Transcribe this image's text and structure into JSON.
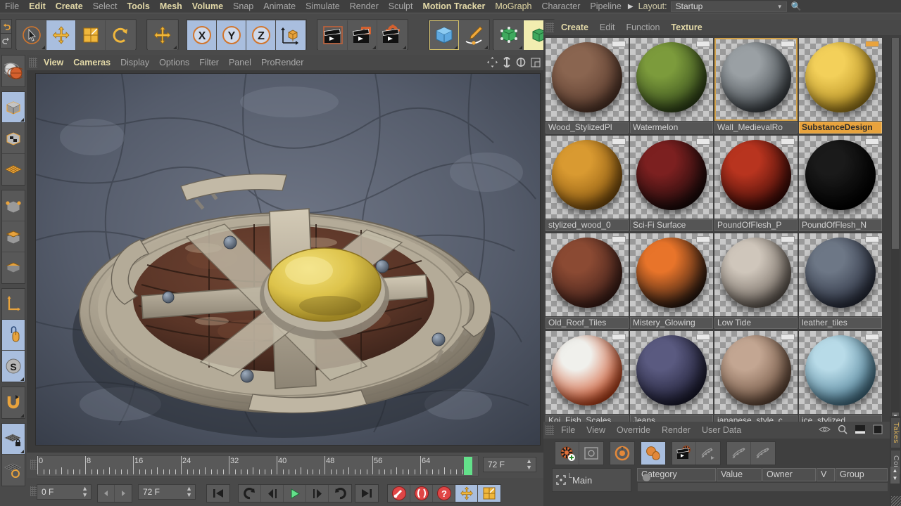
{
  "menubar": {
    "items": [
      {
        "label": "File",
        "state": "dim"
      },
      {
        "label": "Edit",
        "state": "lit"
      },
      {
        "label": "Create",
        "state": "lit"
      },
      {
        "label": "Select",
        "state": "dim"
      },
      {
        "label": "Tools",
        "state": "lit"
      },
      {
        "label": "Mesh",
        "state": "lit"
      },
      {
        "label": "Volume",
        "state": "lit"
      },
      {
        "label": "Snap",
        "state": "dim"
      },
      {
        "label": "Animate",
        "state": "dim"
      },
      {
        "label": "Simulate",
        "state": "dim"
      },
      {
        "label": "Render",
        "state": "dim"
      },
      {
        "label": "Sculpt",
        "state": "dim"
      },
      {
        "label": "Motion Tracker",
        "state": "lit"
      },
      {
        "label": "MoGraph",
        "state": "lit2"
      },
      {
        "label": "Character",
        "state": "dim"
      },
      {
        "label": "Pipeline",
        "state": "dim"
      }
    ],
    "layout_label": "Layout:",
    "layout_value": "Startup",
    "search_icon": "search-icon"
  },
  "toolbar": {
    "undo_redo_group": [
      {
        "icon": "undo-icon"
      },
      {
        "icon": "redo-icon"
      }
    ],
    "selection_group": [
      {
        "icon": "live-selection-icon",
        "state": "normal"
      },
      {
        "icon": "move-icon",
        "state": "selected"
      },
      {
        "icon": "scale-icon",
        "state": "normal"
      },
      {
        "icon": "rotate-icon",
        "state": "normal"
      }
    ],
    "axis_group": [
      {
        "icon": "move-axis-icon",
        "state": "normal"
      }
    ],
    "xyz_group": [
      {
        "icon": "x-axis-icon",
        "label": "X",
        "state": "selected"
      },
      {
        "icon": "y-axis-icon",
        "label": "Y",
        "state": "selected"
      },
      {
        "icon": "z-axis-icon",
        "label": "Z",
        "state": "selected"
      },
      {
        "icon": "world-coordinate-icon",
        "state": "selected"
      }
    ],
    "render_group": [
      {
        "icon": "render-view-icon"
      },
      {
        "icon": "render-to-picture-viewer-icon"
      },
      {
        "icon": "render-settings-icon"
      }
    ],
    "primitive_group": [
      {
        "icon": "cube-primitive-icon",
        "state": "highlight"
      },
      {
        "icon": "spline-pen-icon",
        "state": "normal"
      }
    ],
    "generator_group": [
      {
        "icon": "subdivision-surface-icon",
        "state": "normal"
      },
      {
        "icon": "array-generator-icon",
        "state": "yellow"
      }
    ]
  },
  "left_toolbar": {
    "items": [
      {
        "icon": "transform-object-icon",
        "state": "normal"
      },
      {
        "icon": "model-mode-icon",
        "state": "selected"
      },
      {
        "icon": "texture-mode-icon",
        "state": "normal"
      },
      {
        "icon": "points-mode-icon",
        "state": "normal"
      },
      {
        "icon": "polygon-mode-icon",
        "state": "normal"
      },
      {
        "icon": "edge-mode-icon",
        "state": "normal"
      },
      {
        "icon": "axis-mode-icon",
        "state": "normal"
      },
      {
        "icon": "world-axis-icon",
        "state": "normal"
      },
      {
        "icon": "viewport-solo-icon",
        "state": "selected"
      },
      {
        "icon": "snap-toggle-icon",
        "state": "selected"
      },
      {
        "icon": "magnet-icon",
        "state": "normal"
      },
      {
        "icon": "workplane-lock-icon",
        "state": "selected"
      },
      {
        "icon": "workplane-icon",
        "state": "normal"
      }
    ]
  },
  "viewport": {
    "menu_items": [
      "View",
      "Cameras",
      "Display",
      "Options",
      "Filter",
      "Panel",
      "ProRender"
    ],
    "menu_states": [
      "lit",
      "lit",
      "dim",
      "dim",
      "dim",
      "dim",
      "dim"
    ],
    "corner_icons": [
      "pan-view-icon",
      "dolly-view-icon",
      "rotate-view-icon",
      "maximize-view-icon"
    ],
    "scene_description": "Perspective view of a stylized medieval round wooden shield with stone tiles, metal rim and a golden boss, on rocky ground"
  },
  "timeline": {
    "ruler_labels": [
      "0",
      "8",
      "16",
      "24",
      "32",
      "40",
      "48",
      "56",
      "64"
    ],
    "ruler_values": [
      0,
      8,
      16,
      24,
      32,
      40,
      48,
      56,
      64
    ],
    "range_start": 0,
    "range_end": 72,
    "end_field": "72 F",
    "current_marker_frame": 72
  },
  "transport": {
    "current_frame": "0 F",
    "end_frame": "72 F",
    "buttons": [
      {
        "icon": "go-to-start-icon"
      },
      {
        "icon": "play-backwards-loop-icon"
      },
      {
        "icon": "previous-frame-icon"
      },
      {
        "icon": "play-forward-icon"
      },
      {
        "icon": "next-frame-icon"
      },
      {
        "icon": "play-forwards-loop-icon"
      },
      {
        "icon": "go-to-end-icon"
      },
      {
        "icon": "record-keyframe-icon"
      },
      {
        "icon": "autokeying-icon"
      },
      {
        "icon": "keyframe-selection-icon"
      },
      {
        "icon": "position-key-icon"
      },
      {
        "icon": "scale-key-icon"
      }
    ]
  },
  "material_manager": {
    "menu_items": [
      "Create",
      "Edit",
      "Function",
      "Texture"
    ],
    "menu_states": [
      "lit",
      "dim",
      "dim",
      "lit"
    ],
    "materials": [
      {
        "name": "Wood_StylizedPl",
        "colors": [
          "#8a6550",
          "#5a3b2d"
        ],
        "outlined": false,
        "active": false
      },
      {
        "name": "Watermelon",
        "colors": [
          "#7c9b3c",
          "#34491b"
        ],
        "outlined": false,
        "active": false
      },
      {
        "name": "Wall_MedievalRo",
        "colors": [
          "#9aa0a4",
          "#3e4449"
        ],
        "outlined": true,
        "active": false
      },
      {
        "name": "SubstanceDesign",
        "colors": [
          "#f3d05a",
          "#b08a1e"
        ],
        "outlined": false,
        "active": true
      },
      {
        "name": "stylized_wood_0",
        "colors": [
          "#d99a31",
          "#8a5810"
        ],
        "outlined": false,
        "active": false
      },
      {
        "name": "Sci-Fi Surface",
        "colors": [
          "#7c2020",
          "#1a0a0a"
        ],
        "outlined": false,
        "active": false
      },
      {
        "name": "PoundOfFlesh_P",
        "colors": [
          "#b8341f",
          "#3d0b07"
        ],
        "outlined": false,
        "active": false
      },
      {
        "name": "PoundOfFlesh_N",
        "colors": [
          "#1a1a1a",
          "#000000"
        ],
        "outlined": false,
        "active": false
      },
      {
        "name": "Old_Roof_Tiles",
        "colors": [
          "#8b4a33",
          "#41201a"
        ],
        "outlined": false,
        "active": false
      },
      {
        "name": "Mistery_Glowing",
        "colors": [
          "#e8742a",
          "#2a1a12"
        ],
        "outlined": false,
        "active": false
      },
      {
        "name": "Low Tide",
        "colors": [
          "#cfc6bb",
          "#6c635b"
        ],
        "outlined": false,
        "active": false
      },
      {
        "name": "leather_tiles",
        "colors": [
          "#6d7786",
          "#2a3040"
        ],
        "outlined": false,
        "active": false
      },
      {
        "name": "Koi_Fish_Scales",
        "colors": [
          "#f0f0ec",
          "#d2491c"
        ],
        "outlined": false,
        "active": false
      },
      {
        "name": "Jeans",
        "colors": [
          "#5a5a80",
          "#1d1d33"
        ],
        "outlined": false,
        "active": false
      },
      {
        "name": "japanese_style_c",
        "colors": [
          "#c3a692",
          "#6b4f3d"
        ],
        "outlined": false,
        "active": false
      },
      {
        "name": "ice_stylized",
        "colors": [
          "#b8dbe8",
          "#4c7d95"
        ],
        "outlined": false,
        "active": false
      }
    ]
  },
  "attribute_manager": {
    "menu_items": [
      "File",
      "View",
      "Override",
      "Render",
      "User Data"
    ],
    "menu_states": [
      "dim",
      "dim",
      "dim",
      "dim",
      "dim"
    ],
    "right_icons": [
      "eye-visibility-icon",
      "search-icon",
      "layout-horizontal-icon",
      "layout-vertical-icon"
    ],
    "toolbar_icons": [
      {
        "icon": "add-take-icon"
      },
      {
        "icon": "take-override-icon"
      },
      {
        "icon": "auto-take-icon"
      },
      {
        "icon": "set-as-main-take-icon"
      },
      {
        "icon": "render-take-icon"
      },
      {
        "icon": "override-group-1-icon"
      },
      {
        "icon": "override-group-2-icon"
      },
      {
        "icon": "override-group-3-icon"
      }
    ],
    "tree_root": "Main",
    "columns": [
      "Category",
      "Value",
      "Owner",
      "V",
      "Group"
    ]
  },
  "side_tabs": [
    {
      "label": "Takes",
      "color": "#d9b05a"
    },
    {
      "label": "Con",
      "color": "#b5b5b5"
    }
  ],
  "colors": {
    "accent_orange": "#e8a33d",
    "menu_highlight": "#e3d9a8",
    "selection_blue": "#a9bede",
    "background": "#3b3b3b",
    "panel": "#4a4a4a"
  }
}
